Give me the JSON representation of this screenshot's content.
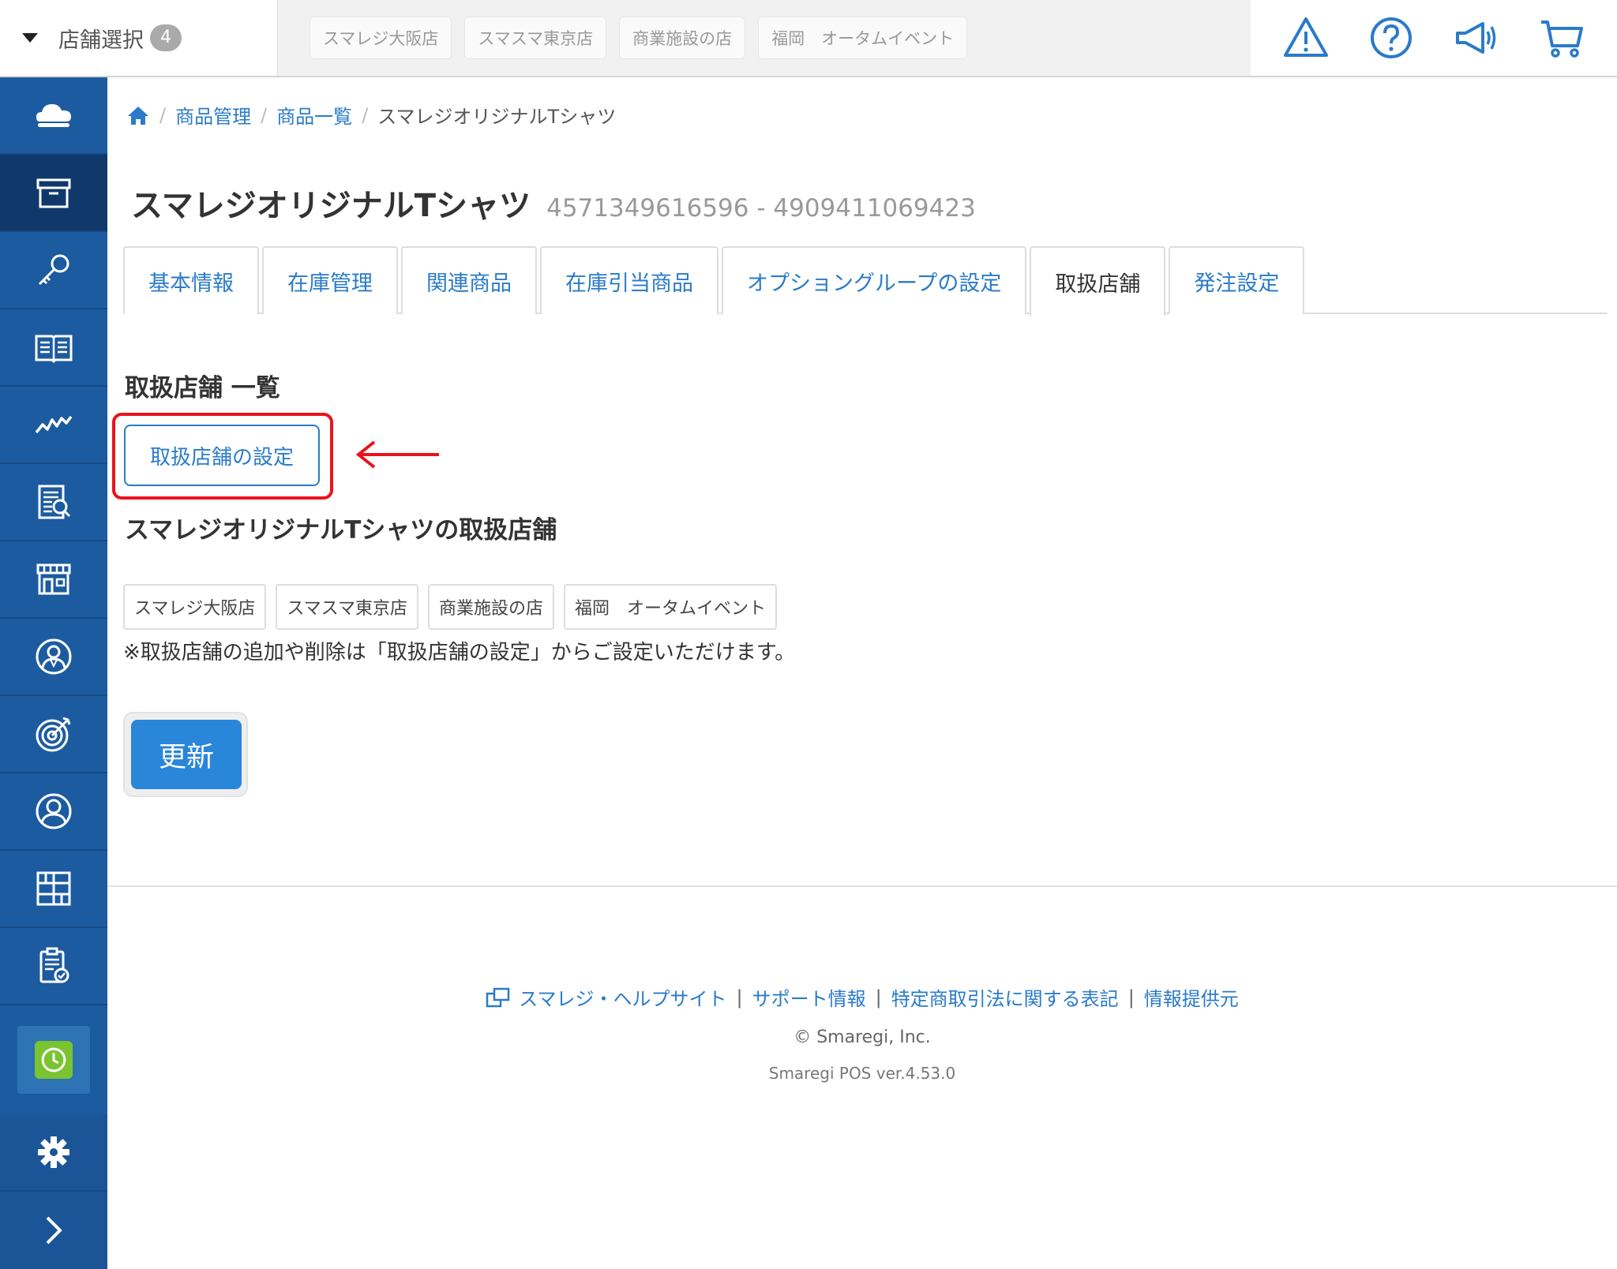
{
  "header": {
    "store_select_label": "店舗選択",
    "store_count": "4",
    "stores": [
      "スマレジ大阪店",
      "スマスマ東京店",
      "商業施設の店",
      "福岡　オータムイベント"
    ]
  },
  "icons": {
    "top": [
      "warning-icon",
      "help-icon",
      "megaphone-icon",
      "cart-icon"
    ],
    "sidebar": [
      "cloud-icon",
      "archive-icon",
      "key-icon",
      "book-icon",
      "chart-icon",
      "report-icon",
      "store-icon",
      "staff-icon",
      "target-icon",
      "customer-icon",
      "grid-icon",
      "clipboard-icon",
      "clock-icon",
      "gear-icon",
      "chevron-right-icon"
    ]
  },
  "colors": {
    "accent": "#2a7bc9",
    "sidebar": "#1d5ba0",
    "highlight": "#e8141c",
    "primary_button": "#2a86d9",
    "clock_green": "#7bc431"
  },
  "breadcrumb": {
    "items": [
      "商品管理",
      "商品一覧"
    ],
    "current": "スマレジオリジナルTシャツ"
  },
  "product": {
    "title": "スマレジオリジナルTシャツ",
    "code": "4571349616596 - 4909411069423"
  },
  "tabs": [
    {
      "label": "基本情報"
    },
    {
      "label": "在庫管理"
    },
    {
      "label": "関連商品"
    },
    {
      "label": "在庫引当商品"
    },
    {
      "label": "オプショングループの設定"
    },
    {
      "label": "取扱店舗",
      "active": true
    },
    {
      "label": "発注設定"
    }
  ],
  "section": {
    "list_title": "取扱店舗 一覧",
    "setting_button": "取扱店舗の設定",
    "stores_title": "スマレジオリジナルTシャツの取扱店舗",
    "stores": [
      "スマレジ大阪店",
      "スマスマ東京店",
      "商業施設の店",
      "福岡　オータムイベント"
    ],
    "note": "※取扱店舗の追加や削除は「取扱店舗の設定」からご設定いただけます。",
    "update_button": "更新"
  },
  "footer": {
    "links": [
      "スマレジ・ヘルプサイト",
      "サポート情報",
      "特定商取引法に関する表記",
      "情報提供元"
    ],
    "copyright": "© Smaregi, Inc.",
    "version": "Smaregi POS ver.4.53.0"
  }
}
